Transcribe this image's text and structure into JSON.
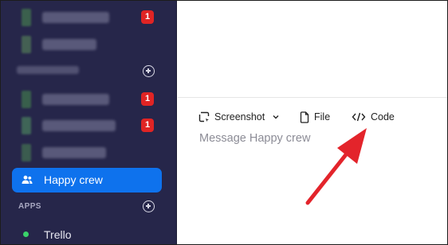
{
  "sidebar": {
    "chats": [
      {
        "badge": "1"
      },
      {
        "badge": ""
      },
      {
        "badge": "1"
      },
      {
        "badge": "1"
      },
      {
        "badge": ""
      }
    ],
    "active_channel": {
      "label": "Happy crew",
      "icon": "users-icon"
    },
    "apps_section_label": "APPS",
    "apps": [
      {
        "label": "Trello",
        "status_color": "#3ad26a"
      }
    ],
    "colors": {
      "background": "#26264a",
      "active": "#0e72ed",
      "badge": "#e02424"
    }
  },
  "toolbar": {
    "screenshot_label": "Screenshot",
    "file_label": "File",
    "code_label": "Code"
  },
  "composer": {
    "placeholder": "Message Happy crew"
  },
  "annotation": {
    "arrow_color": "#e3242b"
  }
}
